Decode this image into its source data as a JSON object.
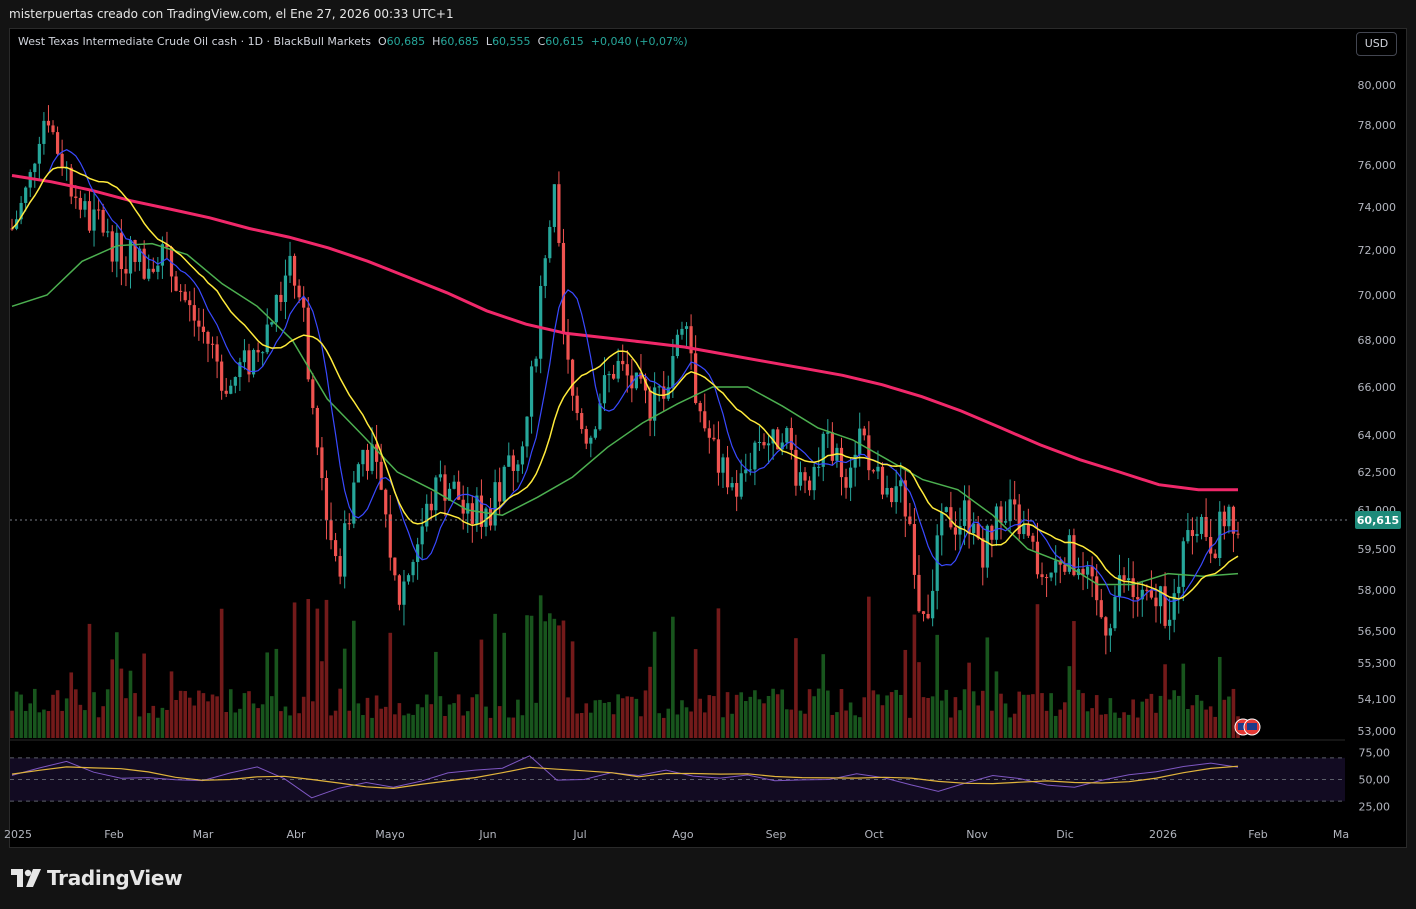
{
  "header": {
    "credit": "misterpuertas creado con TradingView.com, el Ene 27, 2026 00:33 UTC+1"
  },
  "legend": {
    "symbol": "West Texas Intermediate Crude Oil cash · 1D · BlackBull Markets",
    "o_label": "O",
    "o_value": "60,685",
    "h_label": "H",
    "h_value": "60,685",
    "l_label": "L",
    "l_value": "60,555",
    "c_label": "C",
    "c_value": "60,615",
    "change": "+0,040 (+0,07%)"
  },
  "currency": "USD",
  "last_price": "60,615",
  "footer": {
    "brand": "TradingView"
  },
  "colors": {
    "up": "#26a69a",
    "down": "#ef5350",
    "ma200": "#f0286a",
    "ma50": "#4caf50",
    "ma20": "#ffeb3b",
    "ma9": "#3949ff",
    "rsi": "#7e57c2",
    "rsi_ma": "#e0b43c",
    "badge": "#1e8a7a"
  },
  "chart_data": {
    "type": "candlestick",
    "price_axis": {
      "ticks": [
        "80,000",
        "78,000",
        "76,000",
        "74,000",
        "72,000",
        "70,000",
        "68,000",
        "66,000",
        "64,000",
        "62,500",
        "61,000",
        "59,500",
        "58,000",
        "56,500",
        "55,300",
        "54,100",
        "53,000"
      ],
      "ylim": [
        53,
        81
      ]
    },
    "rsi_axis": {
      "ticks": [
        "75,00",
        "50,00",
        "25,00"
      ],
      "ylim": [
        20,
        80
      ]
    },
    "time_axis": {
      "labels": [
        "2025",
        "Feb",
        "Mar",
        "Abr",
        "Mayo",
        "Jun",
        "Jul",
        "Ago",
        "Sep",
        "Oct",
        "Nov",
        "Dic",
        "2026",
        "Feb",
        "Ma"
      ]
    },
    "price_path": [
      73.0,
      74.0,
      75.2,
      77.5,
      78.8,
      77.0,
      76.0,
      74.8,
      74.0,
      73.2,
      73.5,
      72.5,
      72.0,
      71.5,
      72.2,
      71.0,
      71.8,
      72.0,
      71.2,
      70.5,
      69.5,
      68.8,
      68.2,
      67.5,
      66.5,
      66.0,
      66.8,
      67.0,
      67.8,
      68.5,
      69.2,
      70.5,
      71.2,
      70.0,
      66.0,
      63.0,
      61.0,
      58.5,
      60.0,
      62.0,
      63.5,
      63.0,
      62.0,
      60.0,
      57.5,
      58.5,
      59.5,
      60.5,
      61.5,
      62.0,
      62.0,
      61.5,
      60.5,
      61.0,
      60.8,
      61.2,
      62.0,
      62.8,
      63.8,
      65.0,
      68.5,
      72.5,
      74.5,
      68.0,
      65.5,
      64.5,
      64.0,
      65.5,
      66.2,
      67.0,
      66.5,
      66.0,
      65.5,
      65.2,
      65.8,
      66.5,
      68.5,
      69.5,
      66.0,
      64.5,
      63.5,
      62.5,
      62.0,
      61.8,
      62.8,
      63.8,
      64.0,
      63.5,
      64.5,
      63.2,
      62.2,
      62.5,
      63.0,
      63.6,
      63.0,
      62.4,
      63.5,
      64.2,
      63.0,
      62.0,
      61.2,
      62.0,
      61.2,
      58.5,
      57.0,
      58.2,
      60.0,
      60.8,
      60.5,
      61.0,
      60.2,
      59.5,
      60.6,
      60.2,
      60.8,
      60.5,
      59.8,
      59.0,
      58.4,
      58.8,
      59.5,
      59.2,
      58.6,
      58.0,
      57.2,
      56.8,
      57.8,
      58.4,
      57.8,
      57.6,
      57.2,
      57.9,
      57.2,
      57.6,
      59.5,
      61.0,
      60.5,
      59.8,
      60.2,
      60.9,
      60.6
    ],
    "ma200": [
      75.5,
      75.2,
      74.8,
      74.3,
      73.9,
      73.5,
      73.0,
      72.6,
      72.1,
      71.5,
      70.8,
      70.1,
      69.3,
      68.7,
      68.3,
      68.1,
      67.9,
      67.7,
      67.4,
      67.1,
      66.8,
      66.5,
      66.1,
      65.6,
      65.0,
      64.3,
      63.6,
      63.0,
      62.5,
      62.0,
      61.8,
      61.8
    ],
    "ma50": [
      69.5,
      70.0,
      71.5,
      72.2,
      72.3,
      71.8,
      70.5,
      69.5,
      68.0,
      65.5,
      64.0,
      62.5,
      61.8,
      61.0,
      60.8,
      61.5,
      62.3,
      63.5,
      64.5,
      65.3,
      66.0,
      66.0,
      65.2,
      64.3,
      63.8,
      63.0,
      62.2,
      61.8,
      60.8,
      59.5,
      59.0,
      58.2,
      58.2,
      58.6,
      58.5,
      58.6
    ],
    "rsi": [
      55,
      62,
      68,
      58,
      52,
      50,
      48,
      47,
      55,
      60,
      50,
      35,
      42,
      46,
      44,
      50,
      55,
      58,
      62,
      70,
      48,
      52,
      55,
      55,
      60,
      52,
      53,
      56,
      50,
      48,
      52,
      55,
      53,
      45,
      40,
      48,
      52,
      50,
      45,
      42,
      50,
      55,
      58,
      62,
      66,
      63
    ]
  }
}
